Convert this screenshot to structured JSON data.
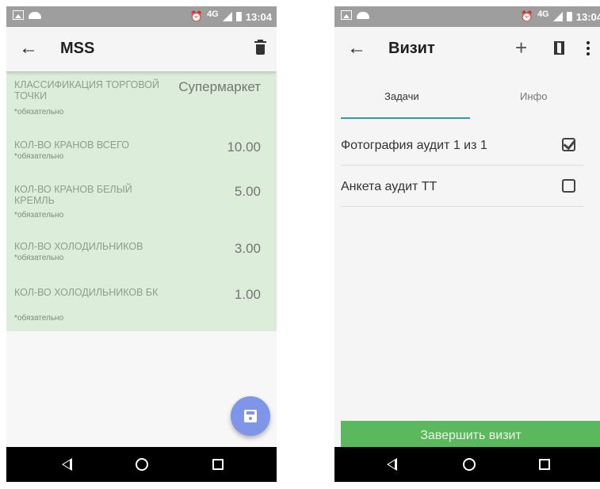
{
  "screen1": {
    "status": {
      "network": "4G",
      "time": "13:04"
    },
    "toolbar": {
      "title": "MSS"
    },
    "fields": [
      {
        "label": "КЛАССИФИКАЦИЯ ТОРГОВОЙ ТОЧКИ",
        "required": "*обязательно",
        "value": "Супермаркет"
      },
      {
        "label": "КОЛ-ВО КРАНОВ ВСЕГО",
        "required": "*обязательно",
        "value": "10.00"
      },
      {
        "label": "КОЛ-ВО КРАНОВ БЕЛЫЙ КРЕМЛЬ",
        "required": "*обязательно",
        "value": "5.00"
      },
      {
        "label": "КОЛ-ВО ХОЛОДИЛЬНИКОВ",
        "required": "*обязательно",
        "value": "3.00"
      },
      {
        "label": "КОЛ-ВО ХОЛОДИЛЬНИКОВ БК",
        "required": "*обязательно",
        "value": "1.00"
      }
    ]
  },
  "screen2": {
    "status": {
      "network": "4G",
      "time": "13:04"
    },
    "toolbar": {
      "title": "Визит",
      "add_label": "+"
    },
    "tabs": [
      {
        "label": "Задачи",
        "active": true
      },
      {
        "label": "Инфо",
        "active": false
      }
    ],
    "tasks": [
      {
        "label": "Фотография аудит 1 из 1",
        "checked": true
      },
      {
        "label": "Анкета аудит ТТ",
        "checked": false
      }
    ],
    "finish_button": "Завершить визит"
  },
  "colors": {
    "form_background": "#dcedda",
    "fab": "#7f96e8",
    "tab_indicator": "#26a69a",
    "finish_button": "#5cb85c",
    "status_bar": "#9e9e9e"
  },
  "icons": [
    "arrow-left-icon",
    "trash-icon",
    "save-icon",
    "plus-icon",
    "map-icon",
    "more-vert-icon",
    "checkbox-checked-icon",
    "checkbox-empty-icon",
    "nav-back-icon",
    "nav-home-icon",
    "nav-recent-icon"
  ]
}
